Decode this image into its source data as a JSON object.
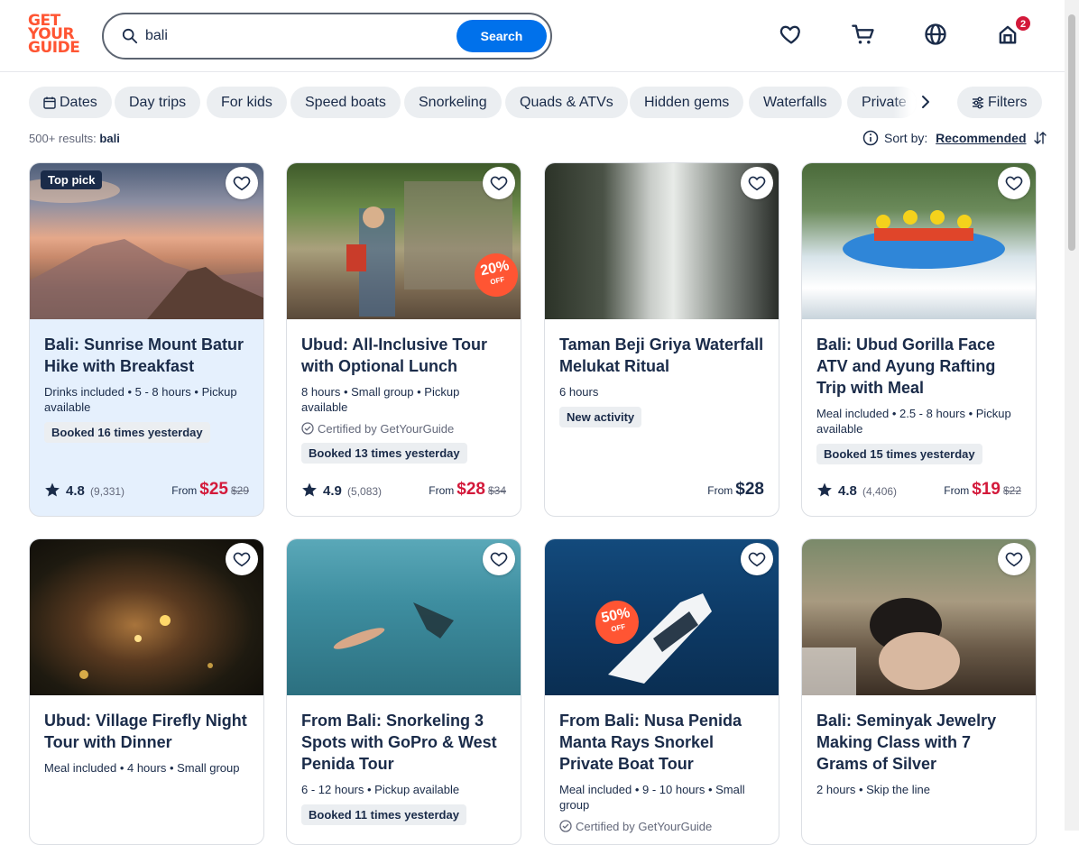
{
  "header": {
    "logo": [
      "GET",
      "YOUR",
      "GUIDE"
    ],
    "search_value": "bali",
    "search_button": "Search",
    "cart_count": "2",
    "icons": [
      "heart-icon",
      "cart-icon",
      "globe-icon",
      "profile-icon"
    ]
  },
  "filters": {
    "chips": [
      "Dates",
      "Day trips",
      "For kids",
      "Speed boats",
      "Snorkeling",
      "Quads & ATVs",
      "Hidden gems",
      "Waterfalls",
      "Private"
    ],
    "filters_label": "Filters"
  },
  "results": {
    "count": "500+ results:",
    "query": "bali",
    "sort_label": "Sort by:",
    "sort_value": "Recommended"
  },
  "cards": [
    {
      "tag": "Top pick",
      "title": "Bali: Sunrise Mount Batur Hike with Breakfast",
      "meta": "Drinks included • 5 - 8 hours • Pickup available",
      "pill": "Booked 16 times yesterday",
      "rating": "4.8",
      "reviews": "(9,331)",
      "from": "From",
      "price": "$25",
      "old_price": "$29"
    },
    {
      "title": "Ubud: All-Inclusive Tour with Optional Lunch",
      "meta": "8 hours • Small group • Pickup available",
      "cert": "Certified by GetYourGuide",
      "pill": "Booked 13 times yesterday",
      "rating": "4.9",
      "reviews": "(5,083)",
      "from": "From",
      "price": "$28",
      "old_price": "$34",
      "discount": "20%",
      "discount_sub": "OFF"
    },
    {
      "title": "Taman Beji Griya Waterfall Melukat Ritual",
      "meta": "6 hours",
      "pill": "New activity",
      "from": "From",
      "price": "$28"
    },
    {
      "title": "Bali: Ubud Gorilla Face ATV and Ayung Rafting Trip with Meal",
      "meta": "Meal included • 2.5 - 8 hours • Pickup available",
      "pill": "Booked 15 times yesterday",
      "rating": "4.8",
      "reviews": "(4,406)",
      "from": "From",
      "price": "$19",
      "old_price": "$22"
    },
    {
      "title": "Ubud: Village Firefly Night Tour with Dinner",
      "meta": "Meal included • 4 hours • Small group"
    },
    {
      "title": "From Bali: Snorkeling 3 Spots with GoPro & West Penida Tour",
      "meta": "6 - 12 hours • Pickup available",
      "pill": "Booked 11 times yesterday"
    },
    {
      "title": "From Bali: Nusa Penida Manta Rays Snorkel Private Boat Tour",
      "meta": "Meal included • 9 - 10 hours • Small group",
      "cert": "Certified by GetYourGuide",
      "discount": "50%",
      "discount_sub": "OFF"
    },
    {
      "title": "Bali: Seminyak Jewelry Making Class with 7 Grams of Silver",
      "meta": "2 hours • Skip the line"
    }
  ],
  "colors": {
    "brand": "#ff5533",
    "accent": "#0071eb",
    "price": "#d3193a",
    "text": "#1a2b49"
  }
}
